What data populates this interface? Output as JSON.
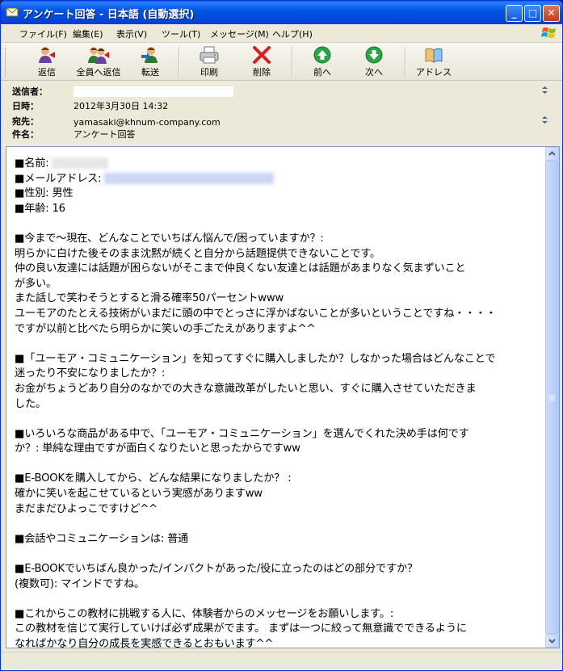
{
  "window": {
    "title": "アンケート回答 - 日本語 (自動選択)",
    "controls": {
      "minimize": "_",
      "maximize": "□",
      "close": "✕"
    }
  },
  "menu": [
    "ファイル(F)",
    "編集(E)",
    "表示(V)",
    "ツール(T)",
    "メッセージ(M)",
    "ヘルプ(H)"
  ],
  "toolbar": {
    "reply": "返信",
    "reply_all": "全員へ返信",
    "forward": "転送",
    "print": "印刷",
    "delete": "削除",
    "previous": "前へ",
    "next": "次へ",
    "address": "アドレス"
  },
  "header": {
    "from_label": "送信者：",
    "date_label": "日時：",
    "date_value": "2012年3月30日 14:32",
    "to_label": "宛先：",
    "to_value": "yamasaki@khnum-company.com",
    "subject_label": "件名：",
    "subject_value": "アンケート回答"
  },
  "body": {
    "name_label": "■名前:",
    "email_label": "■メールアドレス:",
    "rest": "■性別: 男性\n■年齢: 16\n\n■今まで～現在、どんなことでいちばん悩んで/困っていますか？:\n明らかに白けた後そのまま沈黙が続くと自分から話題提供できないことです。\n仲の良い友達には話題が困らないがそこまで仲良くない友達とは話題があまりなく気まずいこと\nが多い。\nまた話しで笑わそうとすると滑る確率50パーセントwww\nユーモアのたとえる技術がいまだに頭の中でとっさに浮かばないことが多いということですね・・・・\nですが以前と比べたら明らかに笑いの手ごたえがありますよ^^\n\n■「ユーモア・コミュニケーション」を知ってすぐに購入しましたか？しなかった場合はどんなことで\n迷ったり不安になりましたか？:\nお金がちょうどあり自分のなかでの大きな意識改革がしたいと思い、すぐに購入させていただきま\nした。\n\n■いろいろな商品がある中で、「ユーモア・コミュニケーション」を選んでくれた決め手は何です\nか？: 単純な理由ですが面白くなりたいと思ったからですww\n\n■E-BOOKを購入してから、どんな結果になりましたか？ :\n確かに笑いを起こせているという実感がありますww\nまだまだひよっこですけど^^\n\n■会話やコミュニケーションは: 普通\n\n■E-BOOKでいちばん良かった/インパクトがあった/役に立ったのはどの部分ですか？\n(複数可): マインドですね。\n\n■これからこの教材に挑戦する人に、体験者からのメッセージをお願いします。:\nこの教材を信じて実行していけば必ず成果がでます。 まずは一つに絞って無意識でできるように\nなればかなり自分の成長を実感できるとおもいます^^"
  },
  "colors": {
    "titlebar": "#0055e5",
    "window_bg": "#ece9d8",
    "body_border": "#7f9db9"
  },
  "icons": [
    "envelope-icon",
    "reply-icon",
    "reply-all-icon",
    "forward-icon",
    "printer-icon",
    "delete-x-icon",
    "up-arrow-icon",
    "down-arrow-icon",
    "address-book-icon",
    "windows-logo-icon"
  ]
}
